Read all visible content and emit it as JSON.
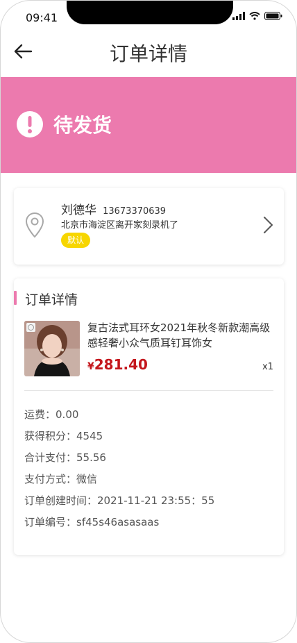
{
  "status_bar": {
    "time": "09:41"
  },
  "header": {
    "title": "订单详情"
  },
  "order_status": {
    "text": "待发货"
  },
  "address": {
    "name": "刘德华",
    "phone": "13673370639",
    "line": "北京市海淀区离开家刻录机了",
    "default_tag": "默认"
  },
  "details": {
    "section_title": "订单详情",
    "product": {
      "name": "复古法式耳环女2021年秋冬新款潮高级感轻奢小众气质耳钉耳饰女",
      "price_symbol": "¥",
      "price": "281.40",
      "quantity": "x1"
    },
    "rows": [
      {
        "label": "运费：",
        "value": "0.00"
      },
      {
        "label": "获得积分：",
        "value": "4545"
      },
      {
        "label": "合计支付：",
        "value": "55.56"
      },
      {
        "label": "支付方式：",
        "value": "微信"
      },
      {
        "label": "订单创建时间：",
        "value": "2021-11-21 23:55：55"
      },
      {
        "label": "订单编号：",
        "value": "sf45s46asasaas"
      }
    ]
  },
  "colors": {
    "accent": "#ec7aae",
    "price": "#c4161c",
    "tag": "#f7d600"
  }
}
